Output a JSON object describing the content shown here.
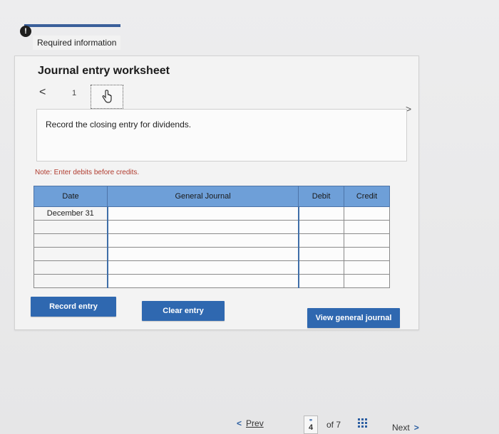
{
  "header": {
    "badge": "!",
    "required_label": "Required information"
  },
  "worksheet": {
    "title": "Journal entry worksheet",
    "nav_prev": "<",
    "current_number": "1",
    "nav_next": ">",
    "instruction": "Record the closing entry for dividends.",
    "note": "Note: Enter debits before credits."
  },
  "table": {
    "headers": {
      "date": "Date",
      "general_journal": "General Journal",
      "debit": "Debit",
      "credit": "Credit"
    },
    "rows": [
      {
        "date": "December 31",
        "account": "",
        "debit": "",
        "credit": ""
      },
      {
        "date": "",
        "account": "",
        "debit": "",
        "credit": ""
      },
      {
        "date": "",
        "account": "",
        "debit": "",
        "credit": ""
      },
      {
        "date": "",
        "account": "",
        "debit": "",
        "credit": ""
      },
      {
        "date": "",
        "account": "",
        "debit": "",
        "credit": ""
      },
      {
        "date": "",
        "account": "",
        "debit": "",
        "credit": ""
      }
    ]
  },
  "buttons": {
    "record_entry": "Record entry",
    "clear_entry": "Clear entry",
    "view_general_journal": "View general journal"
  },
  "pager": {
    "prev_arrow": "<",
    "prev_label": "Prev",
    "current_page": "4",
    "of_label": "of 7",
    "next_label": "Next",
    "next_arrow": ">"
  },
  "colors": {
    "accent": "#2f68b0",
    "table_header": "#6e9fd8",
    "note": "#b03b2e"
  }
}
